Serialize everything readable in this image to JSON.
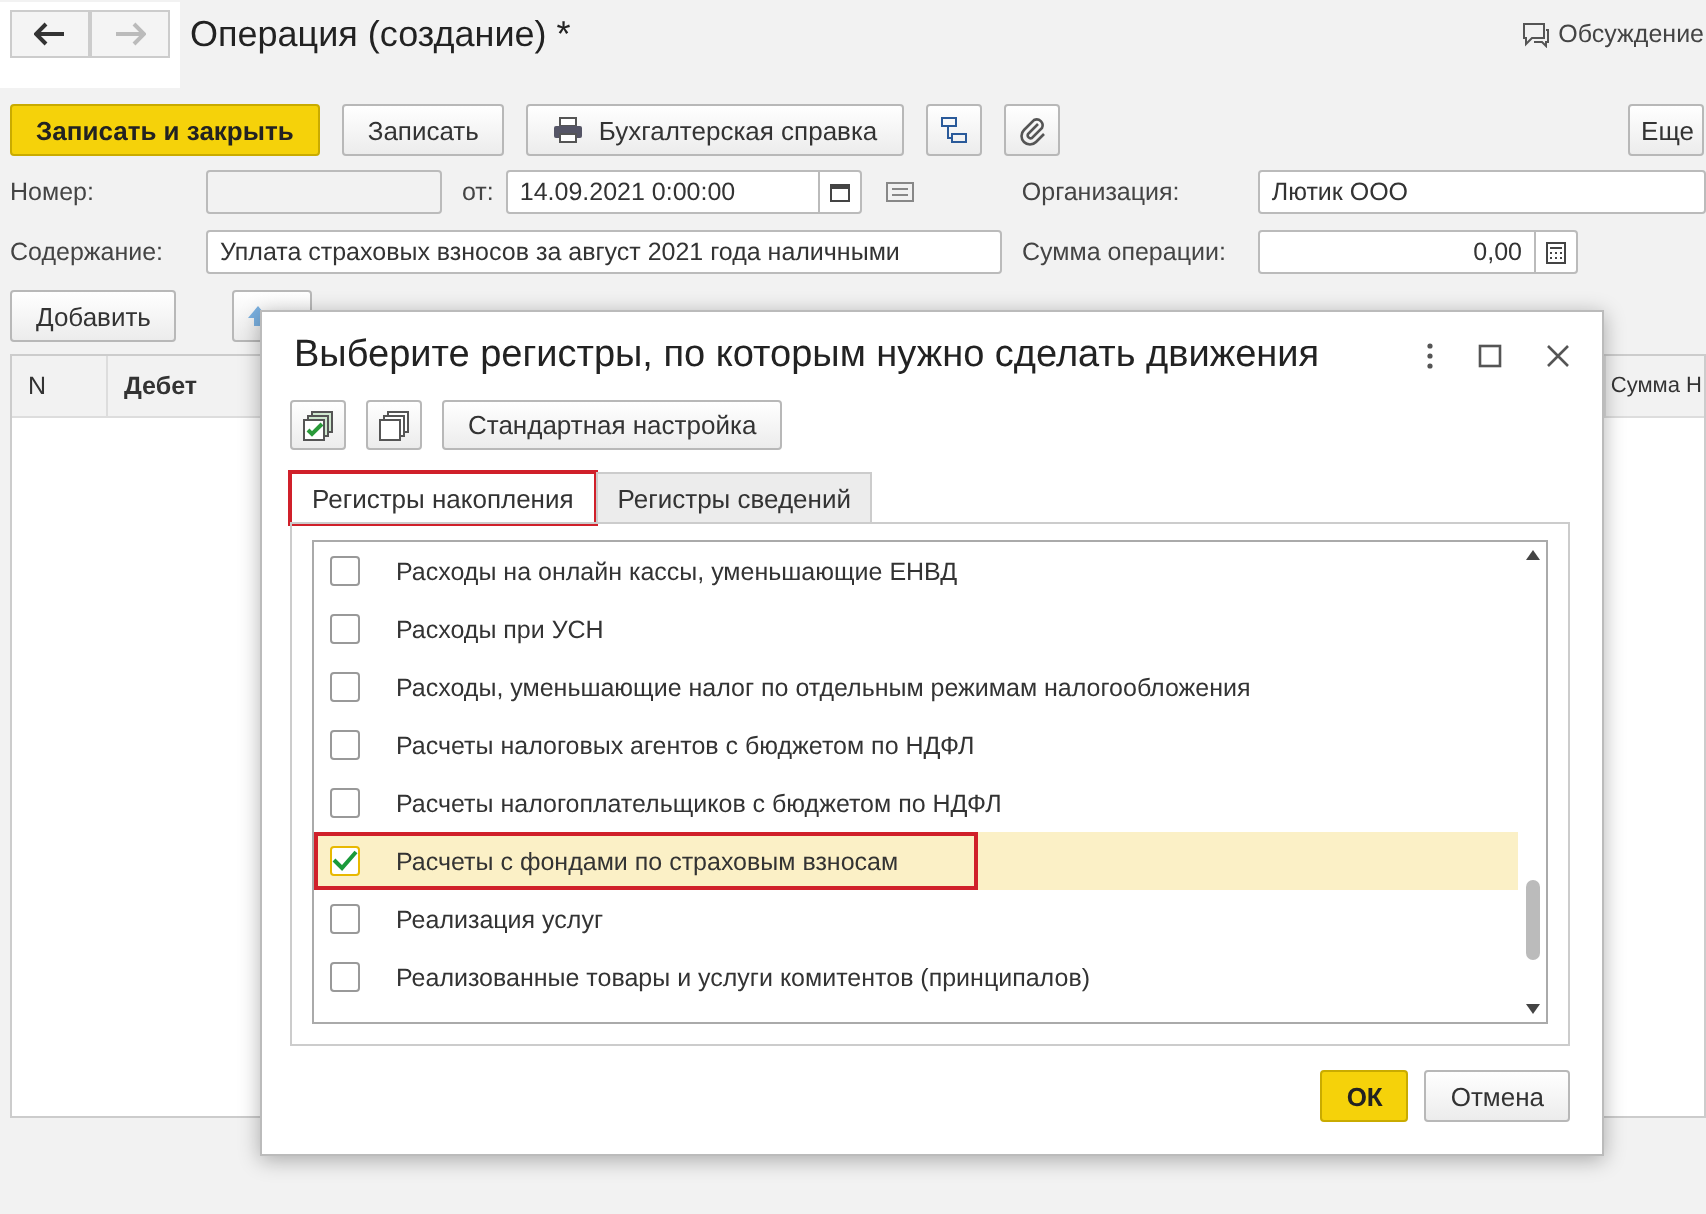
{
  "window": {
    "title": "Операция (создание) *",
    "discussion": "Обсуждение"
  },
  "toolbar": {
    "save_close": "Записать и закрыть",
    "save": "Записать",
    "report": "Бухгалтерская справка",
    "more": "Еще"
  },
  "form": {
    "number_label": "Номер:",
    "from_label": "от:",
    "date": "14.09.2021  0:00:00",
    "org_label": "Организация:",
    "org": "Лютик ООО",
    "content_label": "Содержание:",
    "content": "Уплата страховых взносов за август 2021 года наличными",
    "sum_label": "Сумма операции:",
    "sum": "0,00"
  },
  "table": {
    "add": "Добавить",
    "columns": [
      "N",
      "Дебет",
      "Сумма Н"
    ]
  },
  "dialog": {
    "title": "Выберите регистры, по которым нужно сделать движения",
    "standard": "Стандартная настройка",
    "tabs": [
      {
        "label": "Регистры накопления",
        "selected": true,
        "outlined": true
      },
      {
        "label": "Регистры сведений",
        "selected": false,
        "outlined": false
      }
    ],
    "items": [
      {
        "label": "Расходы на онлайн кассы, уменьшающие ЕНВД",
        "checked": false,
        "selected": false,
        "outlined": false
      },
      {
        "label": "Расходы при УСН",
        "checked": false,
        "selected": false,
        "outlined": false
      },
      {
        "label": "Расходы, уменьшающие налог по отдельным режимам налогообложения",
        "checked": false,
        "selected": false,
        "outlined": false
      },
      {
        "label": "Расчеты налоговых агентов с бюджетом по НДФЛ",
        "checked": false,
        "selected": false,
        "outlined": false
      },
      {
        "label": "Расчеты налогоплательщиков с бюджетом по НДФЛ",
        "checked": false,
        "selected": false,
        "outlined": false
      },
      {
        "label": "Расчеты с фондами по страховым взносам",
        "checked": true,
        "selected": true,
        "outlined": true
      },
      {
        "label": "Реализация услуг",
        "checked": false,
        "selected": false,
        "outlined": false
      },
      {
        "label": "Реализованные товары и услуги комитентов (принципалов)",
        "checked": false,
        "selected": false,
        "outlined": false
      }
    ],
    "ok": "ОК",
    "cancel": "Отмена"
  }
}
